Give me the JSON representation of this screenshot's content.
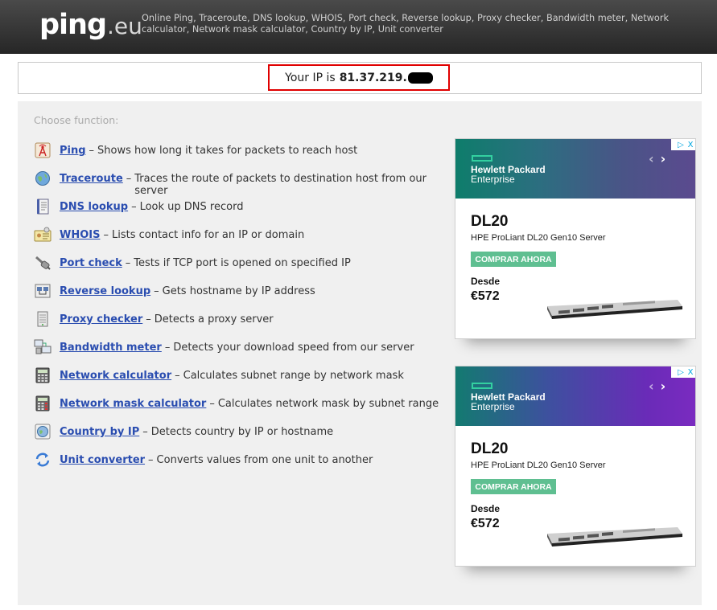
{
  "header": {
    "logo_main": "ping",
    "logo_tld": ".eu",
    "tagline": "Online Ping, Traceroute, DNS lookup, WHOIS, Port check, Reverse lookup, Proxy checker, Bandwidth meter, Network calculator, Network mask calculator, Country by IP, Unit converter"
  },
  "ip": {
    "prefix": "Your IP is",
    "address": "81.37.219."
  },
  "main": {
    "choose_label": "Choose function:",
    "functions": [
      {
        "label": "Ping",
        "description": "Shows how long it takes for packets to reach host",
        "icon": "ping-icon"
      },
      {
        "label": "Traceroute",
        "description": "Traces the route of packets to destination host from our server",
        "icon": "globe-icon"
      },
      {
        "label": "DNS lookup",
        "description": "Look up DNS record",
        "icon": "notebook-icon"
      },
      {
        "label": "WHOIS",
        "description": "Lists contact info for an IP or domain",
        "icon": "id-card-icon"
      },
      {
        "label": "Port check",
        "description": "Tests if TCP port is opened on specified IP",
        "icon": "plug-icon"
      },
      {
        "label": "Reverse lookup",
        "description": "Gets hostname by IP address",
        "icon": "network-icon"
      },
      {
        "label": "Proxy checker",
        "description": "Detects a proxy server",
        "icon": "server-icon"
      },
      {
        "label": "Bandwidth meter",
        "description": "Detects your download speed from our server",
        "icon": "computers-icon"
      },
      {
        "label": "Network calculator",
        "description": "Calculates subnet range by network mask",
        "icon": "calculator-icon"
      },
      {
        "label": "Network mask calculator",
        "description": "Calculates network mask by subnet range",
        "icon": "calculator-red-icon"
      },
      {
        "label": "Country by IP",
        "description": "Detects country by IP or hostname",
        "icon": "world-icon"
      },
      {
        "label": "Unit converter",
        "description": "Converts values from one unit to another",
        "icon": "convert-icon"
      }
    ]
  },
  "ads": [
    {
      "brand_line1": "Hewlett Packard",
      "brand_line2": "Enterprise",
      "title": "DL20",
      "subtitle": "HPE ProLiant DL20 Gen10 Server",
      "cta": "COMPRAR AHORA",
      "from_label": "Desde",
      "price": "€572",
      "prev_arrow": "‹",
      "next_arrow": "›",
      "ad_choices": "▷",
      "ad_close": "X"
    },
    {
      "brand_line1": "Hewlett Packard",
      "brand_line2": "Enterprise",
      "title": "DL20",
      "subtitle": "HPE ProLiant DL20 Gen10 Server",
      "cta": "COMPRAR AHORA",
      "from_label": "Desde",
      "price": "€572",
      "prev_arrow": "‹",
      "next_arrow": "›",
      "ad_choices": "▷",
      "ad_close": "X"
    }
  ],
  "colors": {
    "link": "#2a4db0",
    "highlight_border": "#e00000",
    "cta": "#5fbf91",
    "hpe_green": "#33d0a0"
  }
}
